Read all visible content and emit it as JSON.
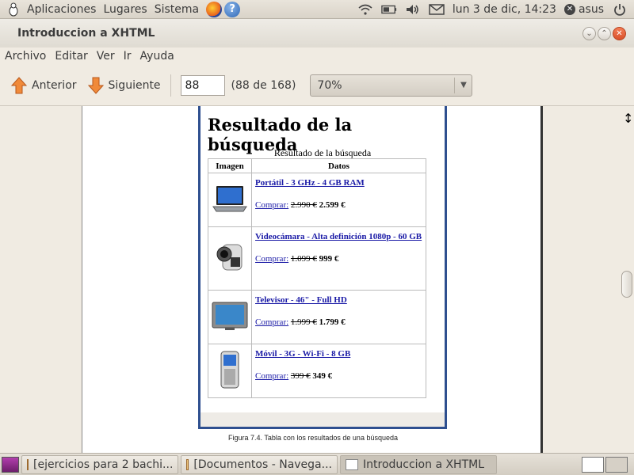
{
  "top_panel": {
    "menus": [
      "Aplicaciones",
      "Lugares",
      "Sistema"
    ],
    "datetime": "lun  3 de dic, 14:23",
    "user": "asus"
  },
  "window": {
    "title": "Introduccion a XHTML"
  },
  "menubar": [
    "Archivo",
    "Editar",
    "Ver",
    "Ir",
    "Ayuda"
  ],
  "toolbar": {
    "prev_label": "Anterior",
    "next_label": "Siguiente",
    "page_value": "88",
    "page_count": "(88 de 168)",
    "zoom_value": "70%"
  },
  "document": {
    "heading": "Resultado de la búsqueda",
    "table_caption": "Resultado de la búsqueda",
    "columns": [
      "Imagen",
      "Datos"
    ],
    "buy_label": "Comprar:",
    "rows": [
      {
        "name": "Portátil - 3 GHz - 4 GB RAM",
        "old_price": "2.990 €",
        "new_price": "2.599 €",
        "icon": "laptop-icon"
      },
      {
        "name": "Videocámara - Alta definición 1080p - 60 GB",
        "old_price": "1.099 €",
        "new_price": "999 €",
        "icon": "camcorder-icon"
      },
      {
        "name": "Televisor - 46\" - Full HD",
        "old_price": "1.999 €",
        "new_price": "1.799 €",
        "icon": "tv-icon"
      },
      {
        "name": "Móvil - 3G - Wi-Fi - 8 GB",
        "old_price": "399 €",
        "new_price": "349 €",
        "icon": "mobile-phone-icon"
      }
    ],
    "figure_caption": "Figura 7.4. Tabla con los resultados de una búsqueda"
  },
  "taskbar": {
    "tasks": [
      {
        "label": "[ejercicios para 2 bachi...",
        "icon": "folder-icon"
      },
      {
        "label": "[Documentos - Navega...",
        "icon": "folder-icon"
      },
      {
        "label": "Introduccion a XHTML",
        "icon": "document-icon"
      }
    ]
  },
  "colors": {
    "link": "#1a1aa6",
    "screenshot_border": "#2e4f8f",
    "close_button": "#e0582f",
    "panel_bg": "#f0ebe2"
  }
}
